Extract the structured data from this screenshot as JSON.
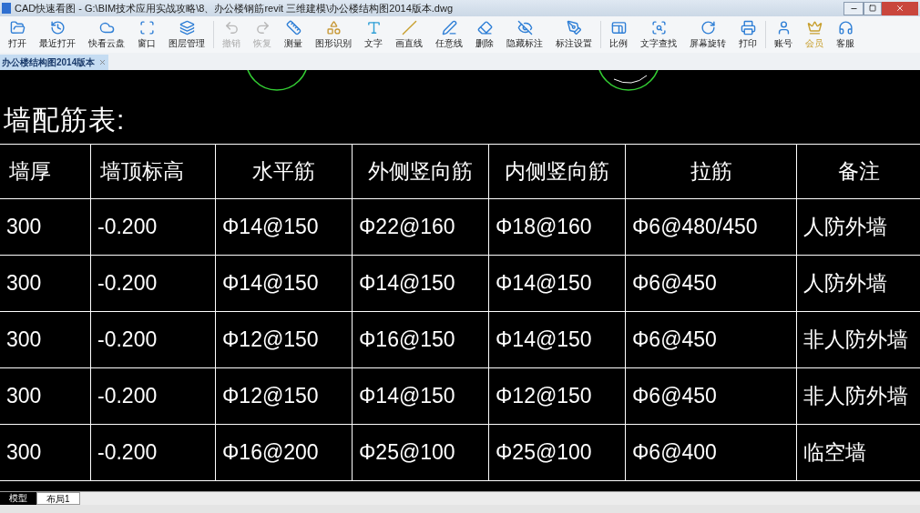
{
  "window": {
    "title": "CAD快速看图 - G:\\BIM技术应用实战攻略\\8、办公楼钢筋revit 三维建模\\办公楼结构图2014版本.dwg"
  },
  "toolbar": [
    {
      "label": "打开",
      "disabled": false
    },
    {
      "label": "最近打开",
      "disabled": false
    },
    {
      "label": "快看云盘",
      "disabled": false
    },
    {
      "label": "窗口",
      "disabled": false
    },
    {
      "label": "图层管理",
      "disabled": false
    },
    {
      "label": "撤销",
      "disabled": true
    },
    {
      "label": "恢复",
      "disabled": true
    },
    {
      "label": "测量",
      "disabled": false
    },
    {
      "label": "图形识别",
      "disabled": false
    },
    {
      "label": "文字",
      "disabled": false
    },
    {
      "label": "画直线",
      "disabled": false
    },
    {
      "label": "任意线",
      "disabled": false
    },
    {
      "label": "删除",
      "disabled": false
    },
    {
      "label": "隐藏标注",
      "disabled": false
    },
    {
      "label": "标注设置",
      "disabled": false
    },
    {
      "label": "比例",
      "disabled": false
    },
    {
      "label": "文字查找",
      "disabled": false
    },
    {
      "label": "屏幕旋转",
      "disabled": false
    },
    {
      "label": "打印",
      "disabled": false
    },
    {
      "label": "账号",
      "disabled": false
    },
    {
      "label": "会员",
      "disabled": false
    },
    {
      "label": "客服",
      "disabled": false
    }
  ],
  "document_tabs": [
    {
      "label": "办公楼结构图2014版本",
      "selected": true
    }
  ],
  "drawing": {
    "title": "墙配筋表:",
    "columns": [
      "墙厚",
      "墙顶标高",
      "水平筋",
      "外侧竖向筋",
      "内侧竖向筋",
      "拉筋",
      "备注"
    ],
    "rows": [
      [
        "300",
        "-0.200",
        "Φ14@150",
        "Φ22@160",
        "Φ18@160",
        "Φ6@480/450",
        "人防外墙"
      ],
      [
        "300",
        "-0.200",
        "Φ14@150",
        "Φ14@150",
        "Φ14@150",
        "Φ6@450",
        "人防外墙"
      ],
      [
        "300",
        "-0.200",
        "Φ12@150",
        "Φ16@150",
        "Φ14@150",
        "Φ6@450",
        "非人防外墙"
      ],
      [
        "300",
        "-0.200",
        "Φ12@150",
        "Φ14@150",
        "Φ12@150",
        "Φ6@450",
        "非人防外墙"
      ],
      [
        "300",
        "-0.200",
        "Φ16@200",
        "Φ25@100",
        "Φ25@100",
        "Φ6@400",
        "临空墙"
      ]
    ]
  },
  "layout_tabs": [
    {
      "label": "模型",
      "selected": true
    },
    {
      "label": "布局1",
      "selected": false
    }
  ]
}
